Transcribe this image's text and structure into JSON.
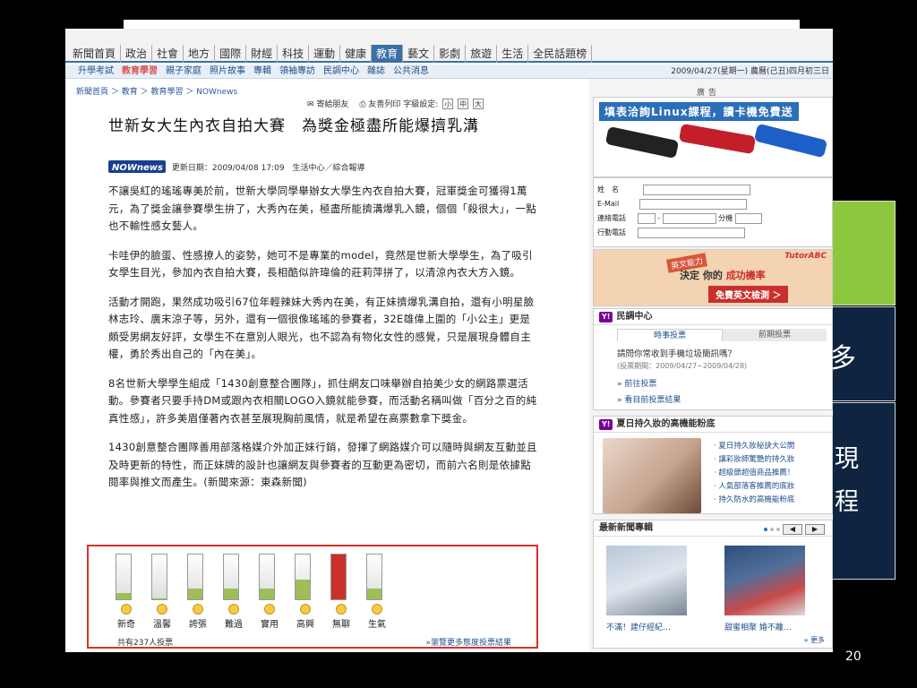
{
  "slide": {
    "number": "20",
    "side_text_1": "多",
    "side_text_2": "現",
    "side_text_3": "程",
    "colors": {
      "green": "#8dc63f",
      "navy": "#0f2440"
    }
  },
  "nav": {
    "tabs": [
      {
        "label": "新聞首頁",
        "active": false
      },
      {
        "label": "政治",
        "active": false
      },
      {
        "label": "社會",
        "active": false
      },
      {
        "label": "地方",
        "active": false
      },
      {
        "label": "國際",
        "active": false
      },
      {
        "label": "財經",
        "active": false
      },
      {
        "label": "科技",
        "active": false
      },
      {
        "label": "運動",
        "active": false
      },
      {
        "label": "健康",
        "active": false
      },
      {
        "label": "教育",
        "active": true
      },
      {
        "label": "藝文",
        "active": false
      },
      {
        "label": "影劇",
        "active": false
      },
      {
        "label": "旅遊",
        "active": false
      },
      {
        "label": "生活",
        "active": false
      },
      {
        "label": "全民話題榜",
        "active": false
      }
    ],
    "subnav": [
      {
        "label": "升學考試",
        "active": false
      },
      {
        "label": "教育學習",
        "active": true
      },
      {
        "label": "親子家庭",
        "active": false
      },
      {
        "label": "照片故事",
        "active": false
      },
      {
        "label": "專輯",
        "active": false
      },
      {
        "label": "領袖專訪",
        "active": false
      },
      {
        "label": "民調中心",
        "active": false
      },
      {
        "label": "雜誌",
        "active": false
      },
      {
        "label": "公共消息",
        "active": false
      }
    ],
    "date": "2009/04/27(星期一) 農曆(己丑)四月初三日"
  },
  "article": {
    "breadcrumb": "新聞首頁 ＞ 教育 ＞ 教育學習 ＞ NOWnews",
    "tools": {
      "send": "寄給朋友",
      "print": "友善列印",
      "font_label": "字級設定:",
      "small": "小",
      "medium": "中",
      "large": "大"
    },
    "title": "世新女大生內衣自拍大賽　為獎金極盡所能爆擠乳溝",
    "source_logo": "NOWnews",
    "meta": "更新日期：2009/04/08 17:09　生活中心／綜合報導",
    "paragraphs": [
      "不讓吳紅的瑤瑤專美於前，世新大學同學舉辦女大學生內衣自拍大賽，冠軍獎金可獲得1萬元，為了獎金讓參賽學生拚了，大秀內在美，極盡所能擠溝爆乳入鏡，個個「殺很大」，一點也不輸性感女藝人。",
      "卡哇伊的臉蛋、性感撩人的姿勢，她可不是專業的model，竟然是世新大學學生，為了吸引女學生目光，參加內衣自拍大賽，長相酷似許瑋倫的莊莉萍拼了，以清涼內衣大方入鏡。",
      "活動才開跑，果然成功吸引67位年輕辣妹大秀內在美，有正妹擠爆乳溝自拍，還有小明星臉林志玲、廣末涼子等，另外，還有一個很像瑤瑤的參賽者，32E雄偉上圍的「小公主」更是頗受男網友好評，女學生不在意別人眼光，也不認為有物化女性的感覺，只是展現身體自主權，勇於秀出自己的「內在美」。",
      "8名世新大學學生組成「1430創意整合團隊」，抓住網友口味舉辦自拍美少女的網路票選活動。參賽者只要手持DM或跟內衣相關LOGO入鏡就能參賽，而活動名稱叫做「百分之百的純真性感」，許多美眉僅著內衣甚至展現胸前風情，就是希望在高票數拿下獎金。",
      "1430創意整合團隊善用部落格媒介外加正妹行銷，發揮了網路媒介可以隨時與網友互動並且及時更新的特性，而正妹牌的設計也讓網友與參賽者的互動更為密切，而前六名則是依據點閱率與推文而產生。(新聞來源：東森新聞)"
    ]
  },
  "vote": {
    "items": [
      {
        "label": "新奇",
        "level": 0.15,
        "red": false
      },
      {
        "label": "溫馨",
        "level": 0.02,
        "red": false
      },
      {
        "label": "誇張",
        "level": 0.25,
        "red": false
      },
      {
        "label": "難過",
        "level": 0.25,
        "red": false
      },
      {
        "label": "實用",
        "level": 0.25,
        "red": false
      },
      {
        "label": "高興",
        "level": 0.45,
        "red": false
      },
      {
        "label": "無聊",
        "level": 1.0,
        "red": true
      },
      {
        "label": "生氣",
        "level": 0.25,
        "red": false
      }
    ],
    "total": "共有237人投票",
    "more": "»瀏覽更多態度投票結果"
  },
  "sidebar": {
    "ad_label": "廣告",
    "ad_banner_title": "填表洽詢Linux課程，讀卡機免費送",
    "form": {
      "name": "姓　名",
      "email": "E-Mail",
      "phone": "連絡電話",
      "ext": "分機",
      "mobile": "行動電話"
    },
    "tutor": {
      "brand": "TutorABC",
      "tag": "英文能力",
      "headline_a": "決定 你的",
      "headline_b": "成功機率",
      "cta": "免費英文檢測 ＞"
    },
    "poll": {
      "badge": "Y!",
      "title": "民調中心",
      "tab_current": "時事投票",
      "tab_past": "前期投票",
      "question": "請問你常收到手機垃圾簡訊嗎？",
      "period": "(投票期間：2009/04/27~2009/04/28)",
      "link_vote": "» 前往投票",
      "link_results": "» 看目前投票結果"
    },
    "summer": {
      "badge": "Y!",
      "title": "夏日持久妝的高機能粉底",
      "items": [
        "夏日持久妝秘訣大公開",
        "讓彩妝師驚艷的持久妝",
        "超級節超值商品推薦！",
        "人氣部落客推薦的底妝",
        "持久防水的高機能粉底"
      ]
    },
    "news": {
      "title": "最新新聞專輯",
      "caption1": "不滿！建仔經紀…",
      "caption2": "甜蜜相聚 婚不離…",
      "more": "» 更多"
    }
  }
}
